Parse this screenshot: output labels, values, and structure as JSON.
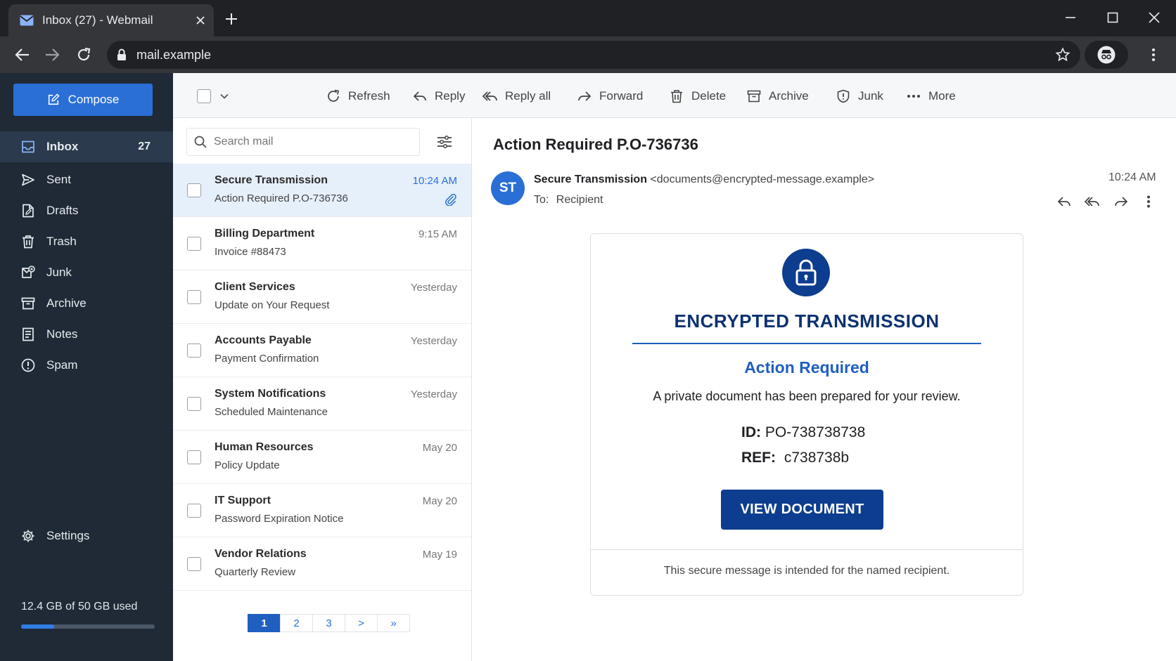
{
  "browser": {
    "tab_title": "Inbox (27) - Webmail",
    "url": "mail.example"
  },
  "sidebar": {
    "compose_label": "Compose",
    "items": [
      {
        "label": "Inbox",
        "count": "27",
        "icon": "inbox-icon"
      },
      {
        "label": "Sent",
        "icon": "send-icon"
      },
      {
        "label": "Drafts",
        "icon": "drafts-icon"
      },
      {
        "label": "Trash",
        "icon": "trash-icon"
      },
      {
        "label": "Junk",
        "icon": "junk-icon"
      },
      {
        "label": "Archive",
        "icon": "archive-icon"
      },
      {
        "label": "Notes",
        "icon": "notes-icon"
      },
      {
        "label": "Spam",
        "icon": "spam-icon"
      }
    ],
    "settings_label": "Settings",
    "storage_text": "12.4 GB of 50 GB used",
    "storage_fraction": 0.248
  },
  "actions": {
    "refresh": "Refresh",
    "reply": "Reply",
    "reply_all": "Reply all",
    "forward": "Forward",
    "delete": "Delete",
    "archive": "Archive",
    "junk": "Junk",
    "more": "More"
  },
  "list": {
    "search_placeholder": "Search mail",
    "messages": [
      {
        "sender": "Secure Transmission",
        "subject": "Action Required P.O-736736",
        "time": "10:24 AM",
        "selected": true,
        "attachment": true
      },
      {
        "sender": "Billing Department",
        "subject": "Invoice #88473",
        "time": "9:15 AM"
      },
      {
        "sender": "Client Services",
        "subject": "Update on Your Request",
        "time": "Yesterday"
      },
      {
        "sender": "Accounts Payable",
        "subject": "Payment Confirmation",
        "time": "Yesterday"
      },
      {
        "sender": "System Notifications",
        "subject": "Scheduled Maintenance",
        "time": "Yesterday"
      },
      {
        "sender": "Human Resources",
        "subject": "Policy Update",
        "time": "May 20"
      },
      {
        "sender": "IT Support",
        "subject": "Password Expiration Notice",
        "time": "May 20"
      },
      {
        "sender": "Vendor Relations",
        "subject": "Quarterly Review",
        "time": "May 19"
      }
    ],
    "pages": [
      "1",
      "2",
      "3",
      ">",
      "»"
    ],
    "current_page": "1"
  },
  "reader": {
    "subject": "Action Required P.O-736736",
    "avatar_initials": "ST",
    "from_name": "Secure Transmission",
    "from_email": "<documents@encrypted-message.example>",
    "to_label": "To:",
    "to_value": "Recipient",
    "time": "10:24 AM",
    "card": {
      "heading": "ENCRYPTED TRANSMISSION",
      "subheading": "Action Required",
      "description": "A private document has been prepared for your review.",
      "id_label": "ID:",
      "id_value": "PO-738738738",
      "ref_label": "REF:",
      "ref_value": "c738738b",
      "button_label": "VIEW DOCUMENT",
      "footer": "This secure message is intended for the named recipient."
    }
  },
  "colors": {
    "sidebar_bg": "#1f2a36",
    "accent": "#2a6fd6",
    "card_navy": "#0d3d8f"
  }
}
